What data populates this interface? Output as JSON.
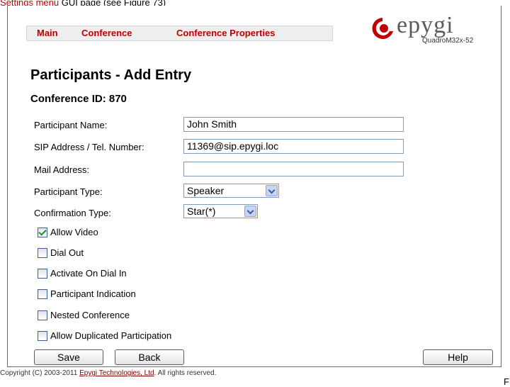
{
  "top_strip": {
    "link": "Settings menu",
    "rest": " GUI page (see Figure 73)"
  },
  "nav": {
    "main": "Main",
    "conference": "Conference",
    "conference_properties": "Conference Properties"
  },
  "logo": {
    "word": "epygi",
    "model": "QuadroM32x-52"
  },
  "page": {
    "title": "Participants - Add Entry",
    "conference_id": "Conference ID: 870"
  },
  "form": {
    "participant_name": {
      "label": "Participant Name:",
      "value": "John Smith"
    },
    "sip_address": {
      "label": "SIP Address / Tel. Number:",
      "value": "11369@sip.epygi.loc"
    },
    "mail_address": {
      "label": "Mail Address:",
      "value": ""
    },
    "participant_type": {
      "label": "Participant Type:",
      "value": "Speaker"
    },
    "confirmation_type": {
      "label": "Confirmation Type:",
      "value": "Star(*)"
    }
  },
  "checkboxes": [
    {
      "label": "Allow Video",
      "checked": true
    },
    {
      "label": "Dial Out",
      "checked": false
    },
    {
      "label": "Activate On Dial In",
      "checked": false
    },
    {
      "label": "Participant Indication",
      "checked": false
    },
    {
      "label": "Nested Conference",
      "checked": false
    },
    {
      "label": "Allow Duplicated Participation",
      "checked": false
    }
  ],
  "buttons": {
    "save": "Save",
    "back": "Back",
    "help": "Help"
  },
  "footer": {
    "prefix": "Copyright (C) 2003-2011 ",
    "company": "Epygi Technologies, Ltd",
    "suffix": ". All rights reserved."
  },
  "edge_char": "F",
  "colors": {
    "accent_red": "#c00000",
    "nav_bg": "#eeeeee",
    "check_green": "#1e8f1e"
  }
}
